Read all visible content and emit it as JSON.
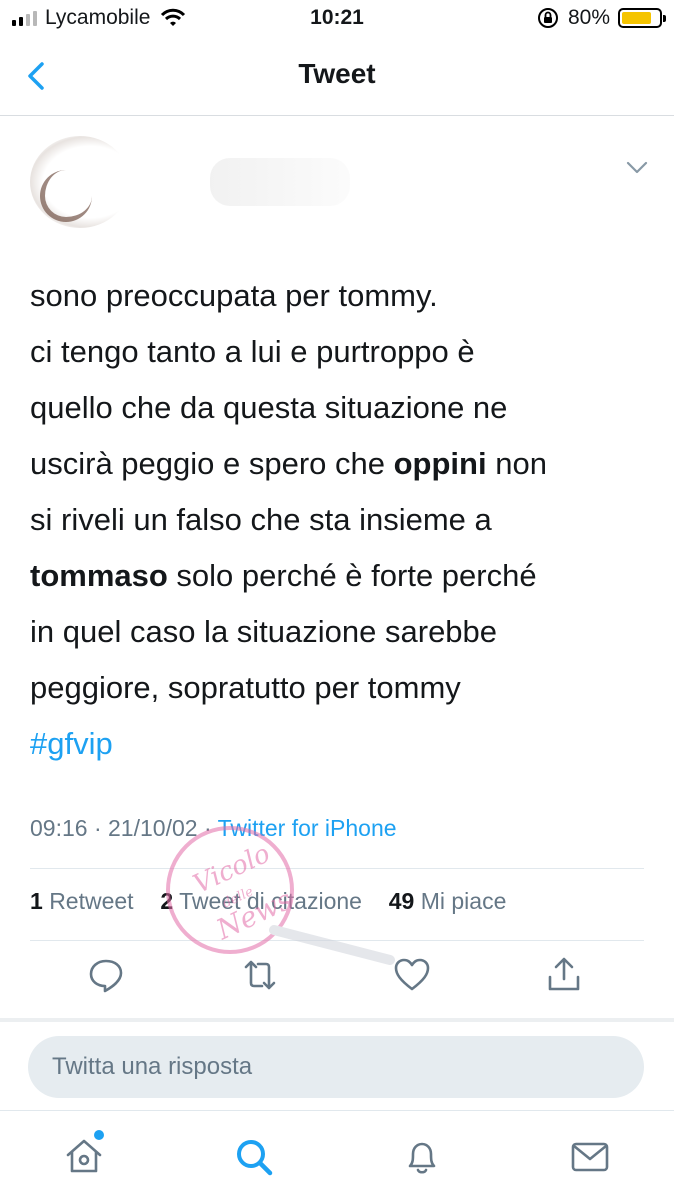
{
  "status_bar": {
    "carrier": "Lycamobile",
    "time": "10:21",
    "battery": "80%",
    "battery_level": 0.8,
    "signal_bars": 2
  },
  "nav": {
    "title": "Tweet"
  },
  "tweet": {
    "lines": [
      {
        "parts": [
          {
            "t": "sono preoccupata per tommy."
          }
        ]
      },
      {
        "parts": [
          {
            "t": "ci tengo tanto a lui e purtroppo è"
          }
        ]
      },
      {
        "parts": [
          {
            "t": "quello che da questa situazione ne"
          }
        ]
      },
      {
        "parts": [
          {
            "t": "uscirà peggio e spero che "
          },
          {
            "t": "oppini",
            "bold": true
          },
          {
            "t": " non"
          }
        ]
      },
      {
        "parts": [
          {
            "t": "si riveli un falso che sta insieme a"
          }
        ]
      },
      {
        "parts": [
          {
            "t": "tommaso",
            "bold": true
          },
          {
            "t": " solo perché è forte perché"
          }
        ]
      },
      {
        "parts": [
          {
            "t": "in quel caso la situazione sarebbe"
          }
        ]
      },
      {
        "parts": [
          {
            "t": "peggiore, sopratutto per tommy"
          }
        ]
      },
      {
        "parts": [
          {
            "t": "#gfvip",
            "hashtag": true
          }
        ]
      }
    ],
    "time": "09:16",
    "date": "21/10/02",
    "source": "Twitter for iPhone",
    "retweets_count": "1",
    "retweets_label": "Retweet",
    "quotes_count": "2",
    "quotes_label": "Tweet di citazione",
    "likes_count": "49",
    "likes_label": "Mi piace"
  },
  "reply": {
    "placeholder": "Twitta una risposta"
  },
  "watermark": {
    "text": "Vicolo delle News"
  },
  "colors": {
    "accent": "#1da1f2",
    "text": "#14171a",
    "muted": "#657786",
    "battery": "#f5c400"
  },
  "icons": {
    "back": "chevron-left-icon",
    "more": "chevron-down-icon",
    "reply": "comment-icon",
    "retweet": "retweet-icon",
    "like": "heart-icon",
    "share": "share-icon",
    "home": "home-icon",
    "search": "search-icon",
    "notifications": "bell-icon",
    "messages": "mail-icon"
  }
}
